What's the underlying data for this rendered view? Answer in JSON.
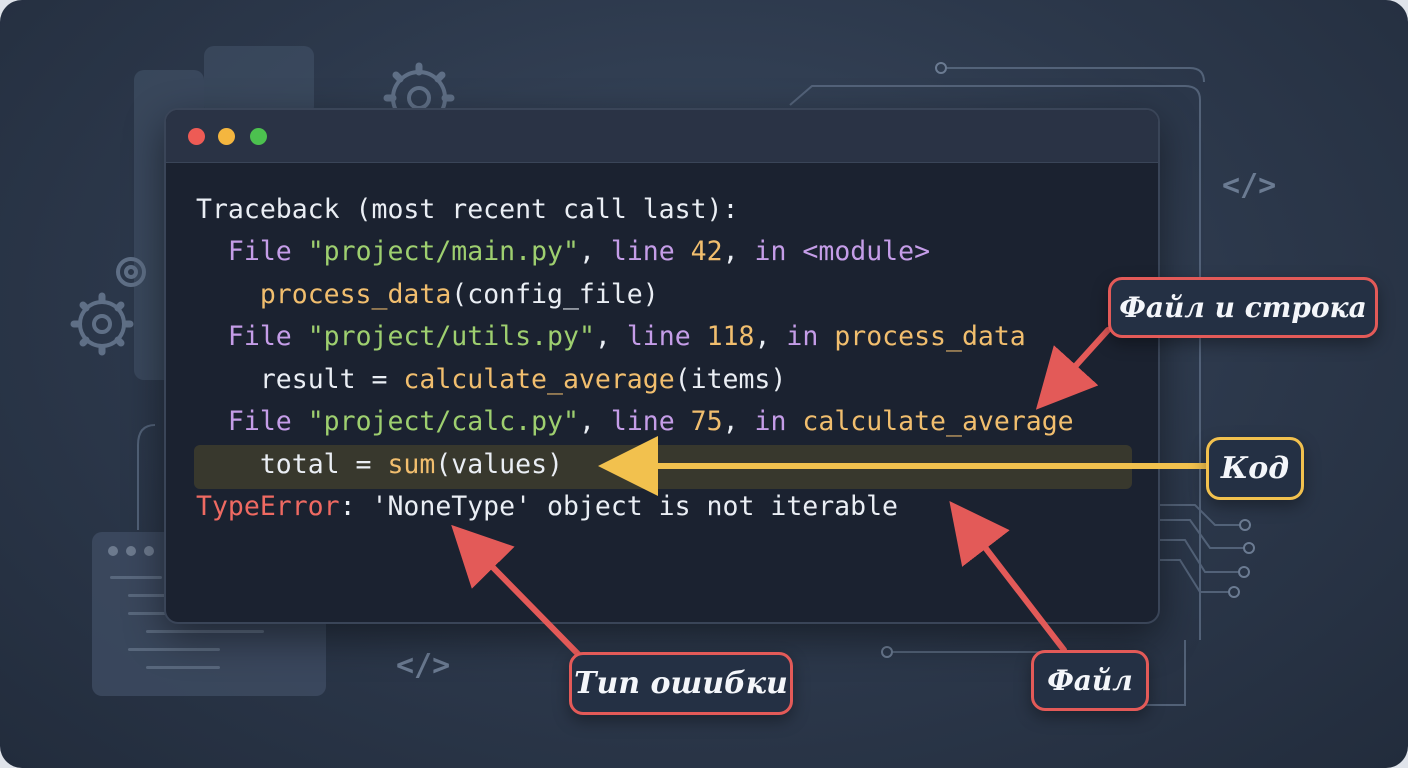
{
  "window": {
    "traffic_lights": [
      {
        "name": "close",
        "color": "#ee5b55"
      },
      {
        "name": "minimize",
        "color": "#f4b63f"
      },
      {
        "name": "maximize",
        "color": "#4cc14f"
      }
    ]
  },
  "traceback": {
    "header": "Traceback (most recent call last):",
    "frames": [
      {
        "file_kw": "File",
        "path": "\"project/main.py\"",
        "line_kw": "line",
        "line_no": "42",
        "in_kw": "in",
        "func": "<module>",
        "code_fn": "process_data",
        "code_rest": "(config_file)"
      },
      {
        "file_kw": "File",
        "path": "\"project/utils.py\"",
        "line_kw": "line",
        "line_no": "118",
        "in_kw": "in",
        "func": "process_data",
        "code_pre": "result = ",
        "code_fn": "calculate_average",
        "code_rest": "(items)"
      },
      {
        "file_kw": "File",
        "path": "\"project/calc.py\"",
        "line_kw": "line",
        "line_no": "75",
        "in_kw": "in",
        "func": "calculate_average",
        "code_pre": "total = ",
        "code_fn": "sum",
        "code_rest": "(values)"
      }
    ],
    "error_type": "TypeError",
    "error_message": ": 'NoneType' object is not iterable"
  },
  "annotations": {
    "file_and_line": "Файл и строка",
    "code": "Код",
    "error_type": "Тип ошибки",
    "file": "Файл"
  },
  "colors": {
    "keyword": "#c59de8",
    "string": "#9ecf6f",
    "number": "#f1be6e",
    "error": "#ef6a62",
    "annotation_red": "#e35a58",
    "annotation_yellow": "#f2c14e",
    "highlight": "#3c3b2e"
  },
  "decor_icons": [
    "gear-icon",
    "code-brackets-icon",
    "circuit-lines"
  ]
}
